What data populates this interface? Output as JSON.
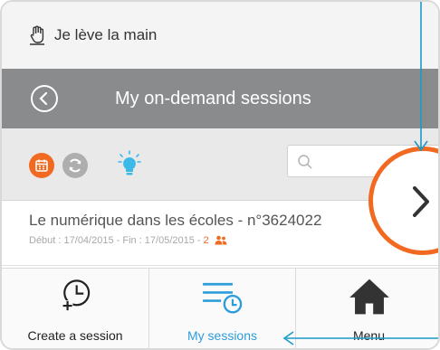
{
  "app": {
    "title": "Je lève la main"
  },
  "titlebar": {
    "title": "My on-demand sessions"
  },
  "toolbar": {
    "search_placeholder": ""
  },
  "session": {
    "title": "Le numérique dans les écoles - n°3624022",
    "meta_dates": "Début : 17/04/2015 - Fin : 17/05/2015 - ",
    "meta_count": "2"
  },
  "tabs": [
    {
      "label": "Create a session"
    },
    {
      "label": "My sessions"
    },
    {
      "label": "Menu"
    }
  ],
  "colors": {
    "accent": "#f26a21",
    "link": "#2d9cdb",
    "titlebar": "#8a8b8d"
  },
  "icons": [
    "hand-raised-icon",
    "back-icon",
    "calendar-icon",
    "sync-icon",
    "lightbulb-icon",
    "search-icon",
    "people-icon",
    "add-clock-icon",
    "list-clock-icon",
    "home-icon",
    "chevron-right-icon"
  ]
}
